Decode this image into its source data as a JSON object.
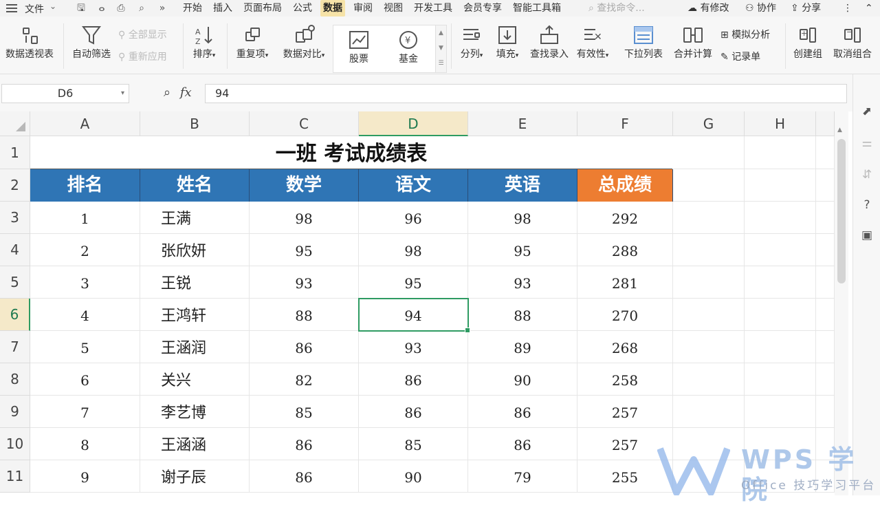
{
  "menubar": {
    "file_label": "文件",
    "tabs": [
      {
        "label": "开始",
        "active": false
      },
      {
        "label": "插入",
        "active": false
      },
      {
        "label": "页面布局",
        "active": false
      },
      {
        "label": "公式",
        "active": false
      },
      {
        "label": "数据",
        "active": true
      },
      {
        "label": "审阅",
        "active": false
      },
      {
        "label": "视图",
        "active": false
      },
      {
        "label": "开发工具",
        "active": false
      },
      {
        "label": "会员专享",
        "active": false
      },
      {
        "label": "智能工具箱",
        "active": false
      }
    ],
    "search_placeholder": "查找命令...",
    "modified_label": "有修改",
    "collab_label": "协作",
    "share_label": "分享"
  },
  "ribbon": {
    "pivot": "数据透视表",
    "autofilter": "自动筛选",
    "show_all": "全部显示",
    "reapply": "重新应用",
    "sort": "排序",
    "duplicates": "重复项",
    "compare": "数据对比",
    "stock": "股票",
    "fund": "基金",
    "split": "分列",
    "fill": "填充",
    "lookup_entry": "查找录入",
    "validity": "有效性",
    "dropdown_list": "下拉列表",
    "consolidate": "合并计算",
    "simulate": "模拟分析",
    "record_form": "记录单",
    "create_group": "创建组",
    "ungroup": "取消组合"
  },
  "formula_bar": {
    "cell_ref": "D6",
    "fx_label": "fx",
    "value": "94"
  },
  "columns": [
    "A",
    "B",
    "C",
    "D",
    "E",
    "F",
    "G",
    "H"
  ],
  "rows": [
    "1",
    "2",
    "3",
    "4",
    "5",
    "6",
    "7",
    "8",
    "9",
    "10",
    "11"
  ],
  "selected_column": "D",
  "selected_row": "6",
  "table": {
    "title": "一班 考试成绩表",
    "headers": [
      "排名",
      "姓名",
      "数学",
      "语文",
      "英语",
      "总成绩"
    ],
    "header_colors": {
      "blue": "#2f75b5",
      "orange": "#ed7d31"
    },
    "rows": [
      [
        "1",
        "王满",
        "98",
        "96",
        "98",
        "292"
      ],
      [
        "2",
        "张欣妍",
        "95",
        "98",
        "95",
        "288"
      ],
      [
        "3",
        "王锐",
        "93",
        "95",
        "93",
        "281"
      ],
      [
        "4",
        "王鸿轩",
        "88",
        "94",
        "88",
        "270"
      ],
      [
        "5",
        "王涵润",
        "86",
        "93",
        "89",
        "268"
      ],
      [
        "6",
        "关兴",
        "82",
        "86",
        "90",
        "258"
      ],
      [
        "7",
        "李艺博",
        "85",
        "86",
        "86",
        "257"
      ],
      [
        "8",
        "王涵涵",
        "86",
        "85",
        "86",
        "257"
      ],
      [
        "9",
        "谢子辰",
        "86",
        "90",
        "79",
        "255"
      ]
    ]
  },
  "watermark": {
    "brand": "WPS 学院",
    "sub": "Office 技巧学习平台"
  }
}
